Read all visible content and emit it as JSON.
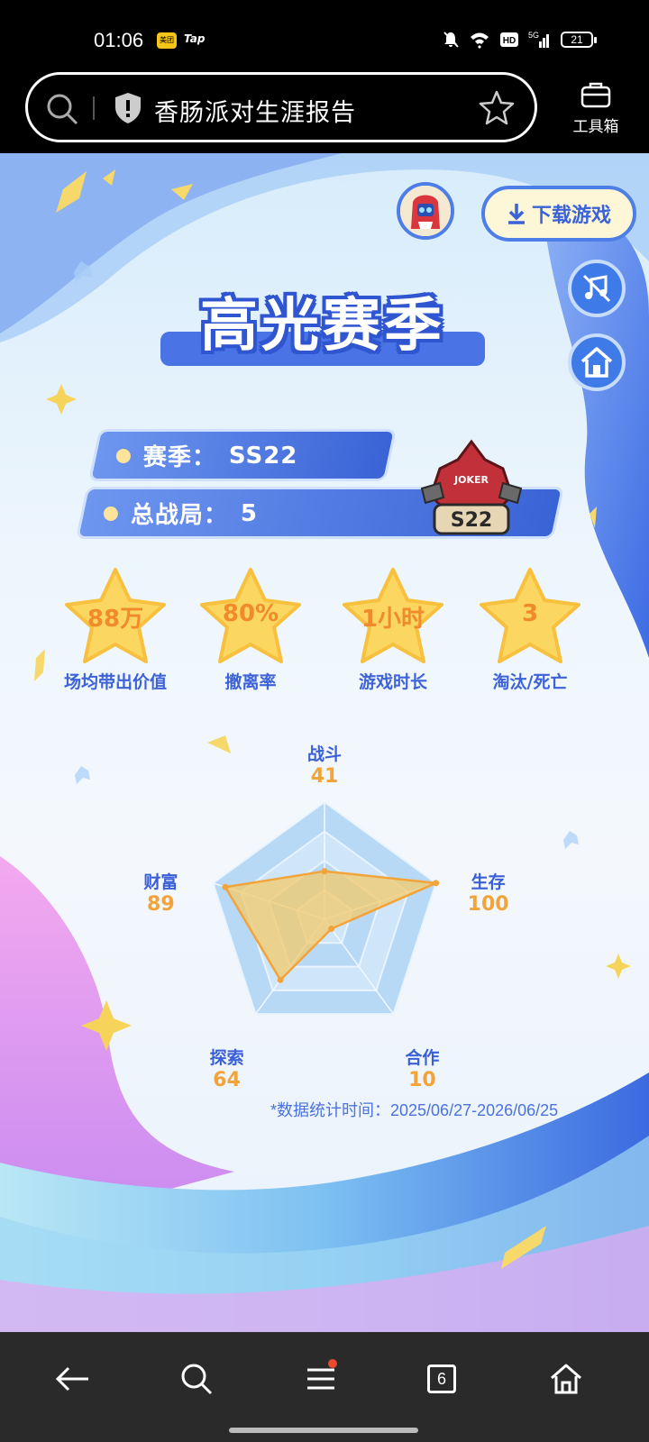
{
  "status_bar": {
    "time": "01:06",
    "app_icon_1": "美团",
    "app_icon_2": "Tap",
    "network": "5G",
    "hd": "HD",
    "battery": "21"
  },
  "address_bar": {
    "page_title": "香肠派对生涯报告",
    "toolbox_label": "工具箱"
  },
  "header": {
    "download_label": "下载游戏"
  },
  "title": "高光赛季",
  "season_info": {
    "season_label": "赛季：",
    "season_value": "SS22",
    "matches_label": "总战局：",
    "matches_value": "5",
    "badge_text": "JOKER",
    "badge_season": "S22"
  },
  "stats": [
    {
      "value": "88万",
      "label": "场均带出价值"
    },
    {
      "value": "80%",
      "label": "撤离率"
    },
    {
      "value": "1小时",
      "label": "游戏时长"
    },
    {
      "value": "3",
      "label": "淘汰/死亡"
    }
  ],
  "radar": {
    "axes": [
      {
        "name": "战斗",
        "value": "41"
      },
      {
        "name": "生存",
        "value": "100"
      },
      {
        "name": "合作",
        "value": "10"
      },
      {
        "name": "探索",
        "value": "64"
      },
      {
        "name": "财富",
        "value": "89"
      }
    ],
    "max": 100,
    "fill_color": "#f3c96a",
    "stroke_color": "#f2a43a",
    "grid_color": "#a9cdf0"
  },
  "footnote": "*数据统计时间：2025/06/27-2026/06/25",
  "nav": {
    "tab_count": "6"
  }
}
